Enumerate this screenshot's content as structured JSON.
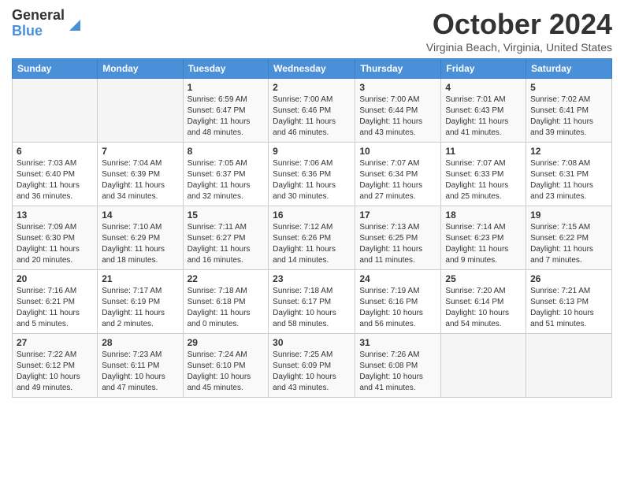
{
  "logo": {
    "general": "General",
    "blue": "Blue"
  },
  "title": "October 2024",
  "location": "Virginia Beach, Virginia, United States",
  "days_of_week": [
    "Sunday",
    "Monday",
    "Tuesday",
    "Wednesday",
    "Thursday",
    "Friday",
    "Saturday"
  ],
  "weeks": [
    [
      {
        "day": "",
        "info": ""
      },
      {
        "day": "",
        "info": ""
      },
      {
        "day": "1",
        "info": "Sunrise: 6:59 AM\nSunset: 6:47 PM\nDaylight: 11 hours and 48 minutes."
      },
      {
        "day": "2",
        "info": "Sunrise: 7:00 AM\nSunset: 6:46 PM\nDaylight: 11 hours and 46 minutes."
      },
      {
        "day": "3",
        "info": "Sunrise: 7:00 AM\nSunset: 6:44 PM\nDaylight: 11 hours and 43 minutes."
      },
      {
        "day": "4",
        "info": "Sunrise: 7:01 AM\nSunset: 6:43 PM\nDaylight: 11 hours and 41 minutes."
      },
      {
        "day": "5",
        "info": "Sunrise: 7:02 AM\nSunset: 6:41 PM\nDaylight: 11 hours and 39 minutes."
      }
    ],
    [
      {
        "day": "6",
        "info": "Sunrise: 7:03 AM\nSunset: 6:40 PM\nDaylight: 11 hours and 36 minutes."
      },
      {
        "day": "7",
        "info": "Sunrise: 7:04 AM\nSunset: 6:39 PM\nDaylight: 11 hours and 34 minutes."
      },
      {
        "day": "8",
        "info": "Sunrise: 7:05 AM\nSunset: 6:37 PM\nDaylight: 11 hours and 32 minutes."
      },
      {
        "day": "9",
        "info": "Sunrise: 7:06 AM\nSunset: 6:36 PM\nDaylight: 11 hours and 30 minutes."
      },
      {
        "day": "10",
        "info": "Sunrise: 7:07 AM\nSunset: 6:34 PM\nDaylight: 11 hours and 27 minutes."
      },
      {
        "day": "11",
        "info": "Sunrise: 7:07 AM\nSunset: 6:33 PM\nDaylight: 11 hours and 25 minutes."
      },
      {
        "day": "12",
        "info": "Sunrise: 7:08 AM\nSunset: 6:31 PM\nDaylight: 11 hours and 23 minutes."
      }
    ],
    [
      {
        "day": "13",
        "info": "Sunrise: 7:09 AM\nSunset: 6:30 PM\nDaylight: 11 hours and 20 minutes."
      },
      {
        "day": "14",
        "info": "Sunrise: 7:10 AM\nSunset: 6:29 PM\nDaylight: 11 hours and 18 minutes."
      },
      {
        "day": "15",
        "info": "Sunrise: 7:11 AM\nSunset: 6:27 PM\nDaylight: 11 hours and 16 minutes."
      },
      {
        "day": "16",
        "info": "Sunrise: 7:12 AM\nSunset: 6:26 PM\nDaylight: 11 hours and 14 minutes."
      },
      {
        "day": "17",
        "info": "Sunrise: 7:13 AM\nSunset: 6:25 PM\nDaylight: 11 hours and 11 minutes."
      },
      {
        "day": "18",
        "info": "Sunrise: 7:14 AM\nSunset: 6:23 PM\nDaylight: 11 hours and 9 minutes."
      },
      {
        "day": "19",
        "info": "Sunrise: 7:15 AM\nSunset: 6:22 PM\nDaylight: 11 hours and 7 minutes."
      }
    ],
    [
      {
        "day": "20",
        "info": "Sunrise: 7:16 AM\nSunset: 6:21 PM\nDaylight: 11 hours and 5 minutes."
      },
      {
        "day": "21",
        "info": "Sunrise: 7:17 AM\nSunset: 6:19 PM\nDaylight: 11 hours and 2 minutes."
      },
      {
        "day": "22",
        "info": "Sunrise: 7:18 AM\nSunset: 6:18 PM\nDaylight: 11 hours and 0 minutes."
      },
      {
        "day": "23",
        "info": "Sunrise: 7:18 AM\nSunset: 6:17 PM\nDaylight: 10 hours and 58 minutes."
      },
      {
        "day": "24",
        "info": "Sunrise: 7:19 AM\nSunset: 6:16 PM\nDaylight: 10 hours and 56 minutes."
      },
      {
        "day": "25",
        "info": "Sunrise: 7:20 AM\nSunset: 6:14 PM\nDaylight: 10 hours and 54 minutes."
      },
      {
        "day": "26",
        "info": "Sunrise: 7:21 AM\nSunset: 6:13 PM\nDaylight: 10 hours and 51 minutes."
      }
    ],
    [
      {
        "day": "27",
        "info": "Sunrise: 7:22 AM\nSunset: 6:12 PM\nDaylight: 10 hours and 49 minutes."
      },
      {
        "day": "28",
        "info": "Sunrise: 7:23 AM\nSunset: 6:11 PM\nDaylight: 10 hours and 47 minutes."
      },
      {
        "day": "29",
        "info": "Sunrise: 7:24 AM\nSunset: 6:10 PM\nDaylight: 10 hours and 45 minutes."
      },
      {
        "day": "30",
        "info": "Sunrise: 7:25 AM\nSunset: 6:09 PM\nDaylight: 10 hours and 43 minutes."
      },
      {
        "day": "31",
        "info": "Sunrise: 7:26 AM\nSunset: 6:08 PM\nDaylight: 10 hours and 41 minutes."
      },
      {
        "day": "",
        "info": ""
      },
      {
        "day": "",
        "info": ""
      }
    ]
  ]
}
